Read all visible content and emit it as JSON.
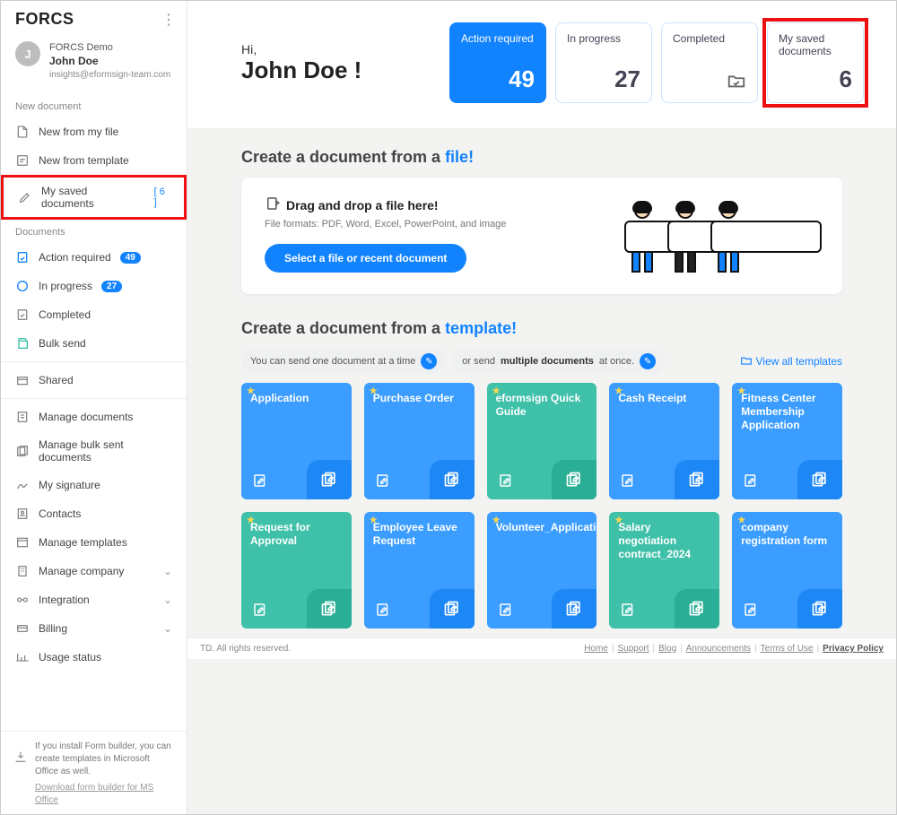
{
  "brand": "FORCS",
  "user": {
    "initial": "J",
    "org": "FORCS Demo",
    "name": "John Doe",
    "email": "insights@eformsign-team.com"
  },
  "sidebar": {
    "section_new": "New document",
    "new_from_file": "New from my file",
    "new_from_template": "New from template",
    "my_saved_docs": "My saved documents",
    "my_saved_badge": "[ 6 ]",
    "section_docs": "Documents",
    "action_required": "Action required",
    "action_required_badge": "49",
    "in_progress": "In progress",
    "in_progress_badge": "27",
    "completed": "Completed",
    "bulk_send": "Bulk send",
    "shared": "Shared",
    "manage_documents": "Manage documents",
    "manage_bulk_sent": "Manage bulk sent documents",
    "my_signature": "My signature",
    "contacts": "Contacts",
    "manage_templates": "Manage templates",
    "manage_company": "Manage company",
    "integration": "Integration",
    "billing": "Billing",
    "usage_status": "Usage status",
    "bottom_text": "If you install Form builder, you can create templates in Microsoft Office as well.",
    "bottom_link": "Download form builder for MS Office"
  },
  "hero": {
    "hi": "Hi,",
    "name": "John Doe !",
    "card_action_label": "Action required",
    "card_action_value": "49",
    "card_progress_label": "In progress",
    "card_progress_value": "27",
    "card_completed_label": "Completed",
    "card_saved_label": "My saved documents",
    "card_saved_value": "6"
  },
  "file_section": {
    "title_prefix": "Create a document from a ",
    "title_accent": "file!",
    "drop_title": "Drag and drop a file here!",
    "drop_sub": "File formats: PDF, Word, Excel, PowerPoint, and image",
    "button": "Select a file or recent document"
  },
  "template_section": {
    "title_prefix": "Create a document from a ",
    "title_accent": "template!",
    "hint_single_pre": "You can send one document at a time",
    "hint_multi_pre": "or send ",
    "hint_multi_bold": "multiple documents",
    "hint_multi_post": " at once.",
    "view_all": "View all templates"
  },
  "templates": [
    {
      "name": "Application",
      "color": "blue"
    },
    {
      "name": "Purchase Order",
      "color": "blue"
    },
    {
      "name": "eformsign Quick Guide",
      "color": "green"
    },
    {
      "name": "Cash Receipt",
      "color": "blue"
    },
    {
      "name": "Fitness Center Membership Application",
      "color": "blue"
    },
    {
      "name": "Request for Approval",
      "color": "green"
    },
    {
      "name": "Employee Leave Request",
      "color": "blue"
    },
    {
      "name": "Volunteer_Application_Form",
      "color": "blue"
    },
    {
      "name": "Salary negotiation contract_2024",
      "color": "green"
    },
    {
      "name": "company registration form",
      "color": "blue"
    }
  ],
  "footer": {
    "copyright": "TD. All rights reserved.",
    "links": [
      "Home",
      "Support",
      "Blog",
      "Announcements",
      "Terms of Use"
    ],
    "privacy": "Privacy Policy"
  }
}
